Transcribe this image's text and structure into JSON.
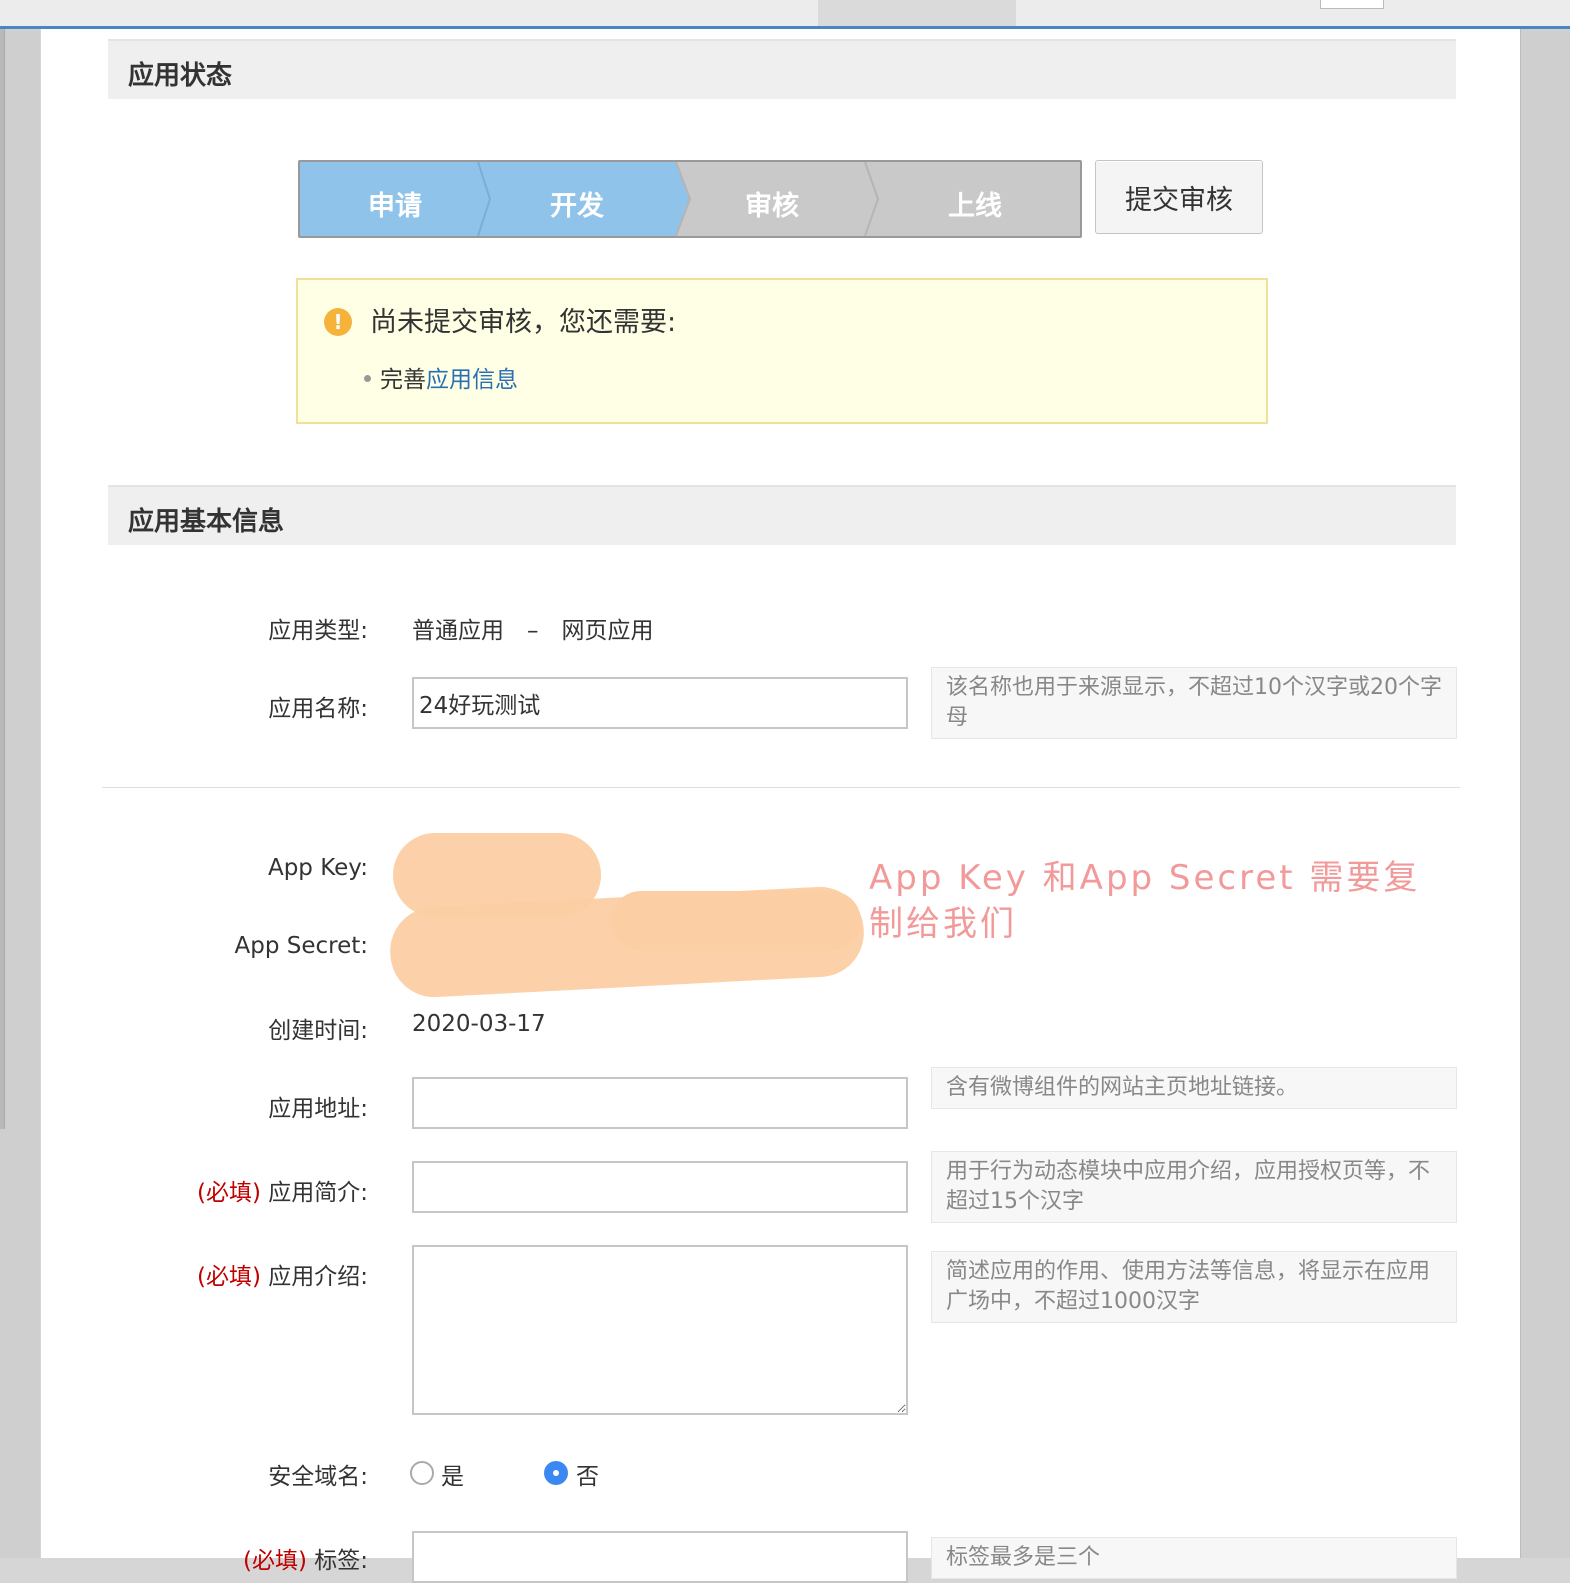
{
  "status": {
    "section_title": "应用状态",
    "steps": [
      {
        "label": "申请",
        "state": "done"
      },
      {
        "label": "开发",
        "state": "current"
      },
      {
        "label": "审核",
        "state": "todo"
      },
      {
        "label": "上线",
        "state": "todo"
      }
    ],
    "submit_label": "提交审核",
    "notice_title": "尚未提交审核，您还需要:",
    "notice_item_prefix": "完善",
    "notice_item_link": "应用信息"
  },
  "basic": {
    "section_title": "应用基本信息",
    "type_label": "应用类型:",
    "type_value": "普通应用　–　网页应用",
    "name_label": "应用名称:",
    "name_value": "24好玩测试",
    "name_hint": "该名称也用于来源显示，不超过10个汉字或20个字母",
    "appkey_label": "App Key:",
    "appsecret_label": "App Secret:",
    "annotation": "App Key 和App Secret  需要复制给我们",
    "created_label": "创建时间:",
    "created_value": "2020-03-17",
    "url_label": "应用地址:",
    "url_hint": "含有微博组件的网站主页地址链接。",
    "required_tag": "(必填)",
    "brief_label": "应用简介:",
    "brief_hint": "用于行为动态模块中应用介绍，应用授权页等，不超过15个汉字",
    "intro_label": "应用介绍:",
    "intro_hint": "简述应用的作用、使用方法等信息，将显示在应用广场中，不超过1000汉字",
    "domain_label": "安全域名:",
    "domain_yes": "是",
    "domain_no": "否",
    "domain_selected": "否",
    "tags_label": "标签:",
    "tags_hint": "标签最多是三个"
  },
  "colors": {
    "step_active": "#8fc3ea",
    "step_inactive": "#c9c9c9",
    "link": "#2a6fb5",
    "required": "#c00000",
    "annotation": "#f29a9a",
    "redaction": "#fccea3"
  }
}
